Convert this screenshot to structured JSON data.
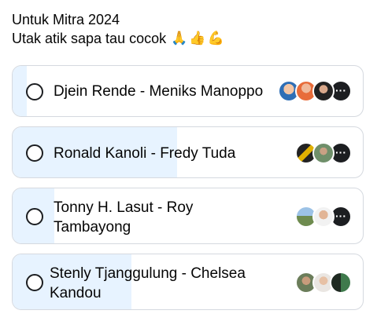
{
  "post": {
    "title": "Untuk Mitra 2024",
    "subtitle": "Utak atik sapa tau cocok",
    "emojis": [
      "🙏",
      "👍",
      "💪"
    ]
  },
  "poll": {
    "options": [
      {
        "label": "Djein Rende - Meniks Manoppo",
        "vote_fraction": 0.04,
        "more": "···"
      },
      {
        "label": "Ronald Kanoli - Fredy Tuda",
        "vote_fraction": 0.47,
        "more": "···"
      },
      {
        "label_lines": [
          "Tonny H. Lasut - Roy",
          "Tambayong"
        ],
        "vote_fraction": 0.12,
        "more": "···"
      },
      {
        "label_lines": [
          "Stenly Tjanggulung -  Chelsea",
          "Kandou"
        ],
        "vote_fraction": 0.34,
        "more": ""
      }
    ]
  },
  "colors": {
    "fill": "#e7f3ff",
    "border": "#d5d9df",
    "text": "#050505"
  },
  "icons": [
    "radio-icon",
    "avatar-icon",
    "more-icon"
  ]
}
